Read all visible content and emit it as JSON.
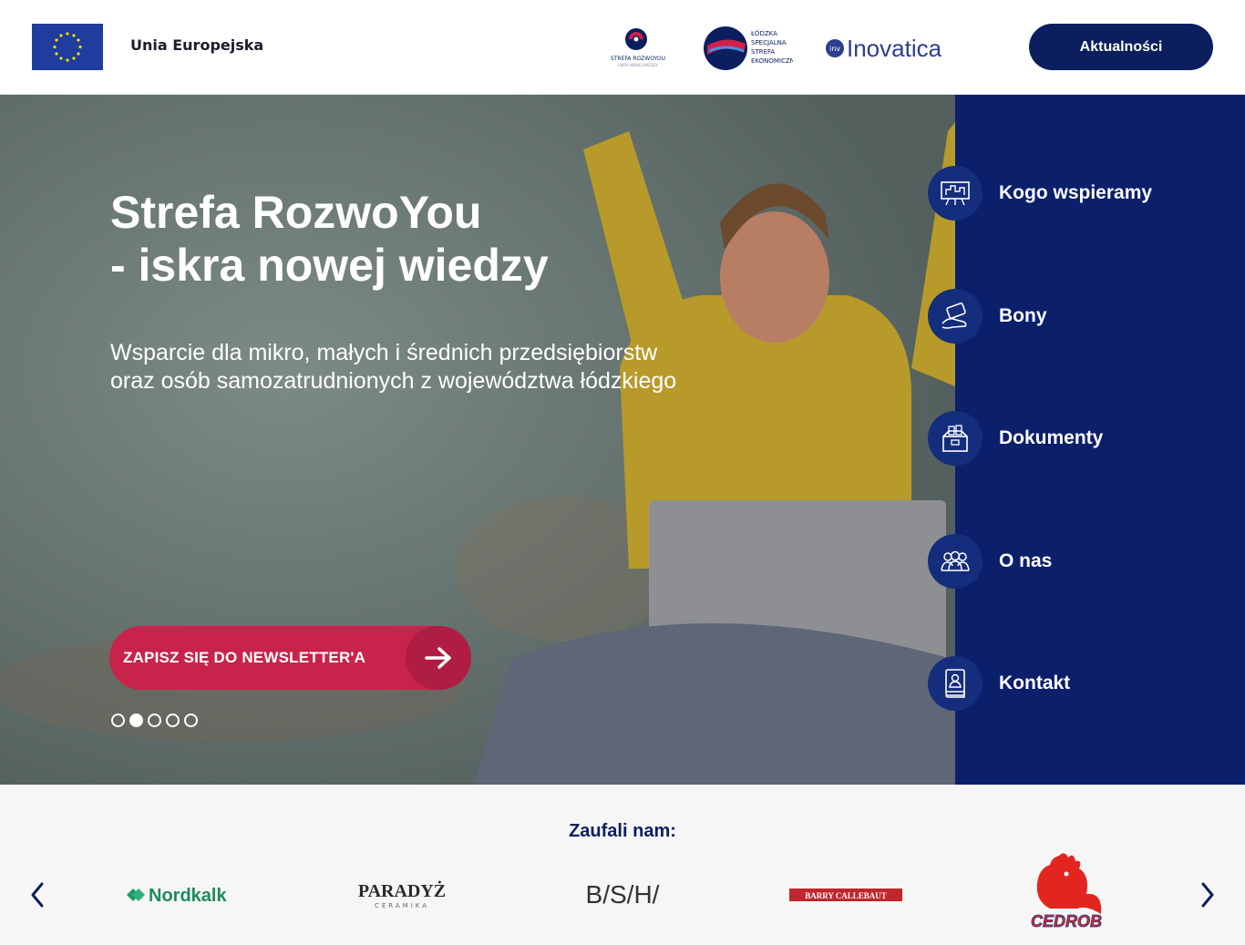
{
  "header": {
    "eu_label": "Unia Europejska",
    "news_button": "Aktualności",
    "logos": {
      "rozwoyou_line1": "STREFA ROZWOYOU",
      "rozwoyou_line2": "ISKRA NOWEJ WIEDZY",
      "lsse_line1": "ŁÓDZKA",
      "lsse_line2": "SPECJALNA",
      "lsse_line3": "STREFA",
      "lsse_line4": "EKONOMICZNA",
      "inovatica_badge": "inv",
      "inovatica": "Inovatica"
    }
  },
  "hero": {
    "title_line1": "Strefa RozwoYou",
    "title_line2": "- iskra nowej wiedzy",
    "subtitle_line1": "Wsparcie dla mikro, małych i średnich przedsiębiorstw",
    "subtitle_line2": "oraz osób samozatrudnionych z województwa łódzkiego",
    "cta_label": "ZAPISZ SIĘ DO NEWSLETTER'A",
    "slides_total": 5,
    "active_slide": 2
  },
  "side_nav": {
    "items": [
      {
        "label": "Kogo wspieramy",
        "icon": "presentation-board-icon"
      },
      {
        "label": "Bony",
        "icon": "voucher-hand-icon"
      },
      {
        "label": "Dokumenty",
        "icon": "documents-box-icon"
      },
      {
        "label": "O nas",
        "icon": "team-people-icon"
      },
      {
        "label": "Kontakt",
        "icon": "contact-book-icon"
      }
    ]
  },
  "partners": {
    "title": "Zaufali nam:",
    "logos": {
      "nordkalk": "Nordkalk",
      "paradyz": "PARADYŻ",
      "paradyz_sub": "CERAMIKA",
      "bsh": "B/S/H/",
      "barry": "BARRY CALLEBAUT",
      "cedrob": "CEDROB"
    }
  },
  "colors": {
    "navy": "#0b1f5e",
    "side_navy": "#0b1f6b",
    "cta_red": "#c8234b"
  }
}
